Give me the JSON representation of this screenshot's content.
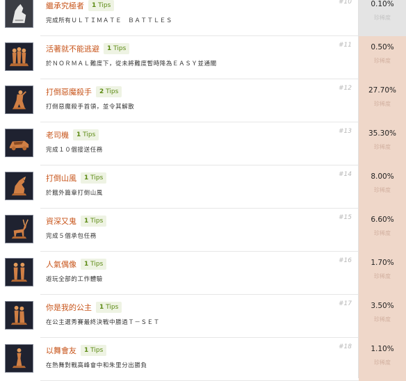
{
  "achievements": [
    {
      "title": "繼承究極者",
      "tips_count": "1",
      "tips_word": "Tips",
      "desc": "完成所有ＵＬＴＩＭＡＴＥ　ＢＡＴＴＬＥＳ",
      "index": "#10",
      "rate": "0.10%",
      "rate_label": "珍稀度",
      "icon": "wolf-trophy-icon"
    },
    {
      "title": "活著就不能逃避",
      "tips_count": "1",
      "tips_word": "Tips",
      "desc": "於ＮＯＲＭＡＬ難度下，從未將難度暫時降為ＥＡＳＹ並通關",
      "index": "#11",
      "rate": "0.50%",
      "rate_label": "珍稀度",
      "icon": "group-figures-trophy-icon"
    },
    {
      "title": "打倒惡魔殺手",
      "tips_count": "2",
      "tips_word": "Tips",
      "desc": "打倒惡魔殺手首領，並令其解散",
      "index": "#12",
      "rate": "27.70%",
      "rate_label": "珍稀度",
      "icon": "fighter-trophy-icon"
    },
    {
      "title": "老司機",
      "tips_count": "1",
      "tips_word": "Tips",
      "desc": "完成１０個接送任務",
      "index": "#13",
      "rate": "35.30%",
      "rate_label": "珍稀度",
      "icon": "car-trophy-icon"
    },
    {
      "title": "打倒山風",
      "tips_count": "1",
      "tips_word": "Tips",
      "desc": "於餓外篇章打倒山風",
      "index": "#14",
      "rate": "8.00%",
      "rate_label": "珍稀度",
      "icon": "beast-trophy-icon"
    },
    {
      "title": "資深又鬼",
      "tips_count": "1",
      "tips_word": "Tips",
      "desc": "完成５個承包任務",
      "index": "#15",
      "rate": "6.60%",
      "rate_label": "珍稀度",
      "icon": "deer-trophy-icon"
    },
    {
      "title": "人氣偶像",
      "tips_count": "1",
      "tips_word": "Tips",
      "desc": "遊玩全部的工作體驗",
      "index": "#16",
      "rate": "1.70%",
      "rate_label": "珍稀度",
      "icon": "duo-figures-trophy-icon"
    },
    {
      "title": "你是我的公主",
      "tips_count": "1",
      "tips_word": "Tips",
      "desc": "在公主選秀賽最終決戰中勝過Ｔ－ＳＥＴ",
      "index": "#17",
      "rate": "3.50%",
      "rate_label": "珍稀度",
      "icon": "couple-trophy-icon"
    },
    {
      "title": "以舞會友",
      "tips_count": "1",
      "tips_word": "Tips",
      "desc": "在熱舞對戰高峰會中和朱里分出勝負",
      "index": "#18",
      "rate": "1.10%",
      "rate_label": "珍稀度",
      "icon": "dancer-trophy-icon"
    }
  ],
  "colors": {
    "accent_title": "#c8561c",
    "tips_bg": "#eef3e3",
    "tips_text": "#5b8a12",
    "rate_bg": "#efd7c9"
  }
}
